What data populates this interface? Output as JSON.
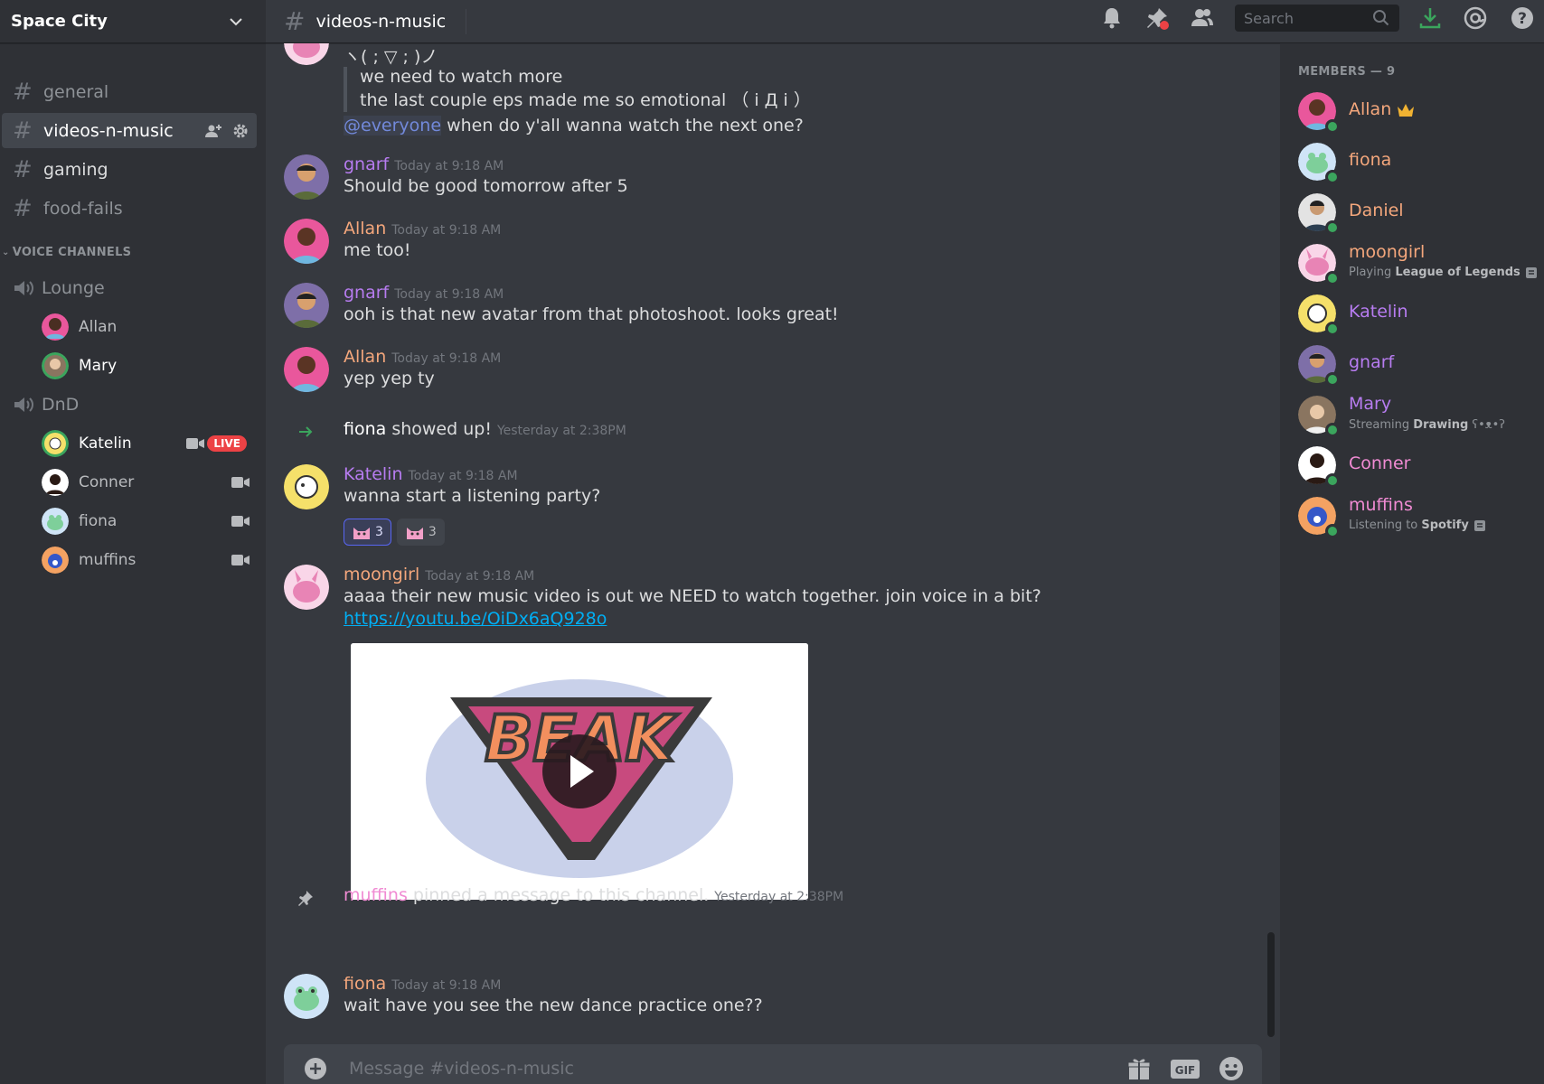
{
  "server": {
    "name": "Space City"
  },
  "text_channels": [
    {
      "name": "general",
      "state": "normal"
    },
    {
      "name": "videos-n-music",
      "state": "active"
    },
    {
      "name": "gaming",
      "state": "unread"
    },
    {
      "name": "food-fails",
      "state": "normal"
    }
  ],
  "voice": {
    "header": "VOICE CHANNELS",
    "channels": [
      {
        "name": "Lounge",
        "users": [
          {
            "name": "Allan"
          },
          {
            "name": "Mary"
          }
        ]
      },
      {
        "name": "DnD",
        "users": [
          {
            "name": "Katelin",
            "video": true,
            "live": "LIVE"
          },
          {
            "name": "Conner",
            "video": true
          },
          {
            "name": "fiona",
            "video": true
          },
          {
            "name": "muffins",
            "video": true
          }
        ]
      }
    ]
  },
  "header": {
    "channel": "videos-n-music",
    "search_placeholder": "Search"
  },
  "messages": {
    "top_kaomoji": "ヽ( ; ▽ ; )ノ",
    "quote_line1": "we need to watch more",
    "quote_line2": "the last couple eps made me so emotional （ i Д i ）",
    "everyone_mention": "@everyone",
    "everyone_text": " when do y'all wanna watch the next one?",
    "items": [
      {
        "author": "gnarf",
        "time": "Today at 9:18 AM",
        "text": "Should be good tomorrow after 5",
        "color": "#b77cf0"
      },
      {
        "author": "Allan",
        "time": "Today at 9:18 AM",
        "text": "me too!",
        "color": "#f4a77c"
      },
      {
        "author": "gnarf",
        "time": "Today at 9:18 AM",
        "text": "ooh is that new avatar from that photoshoot. looks great!",
        "color": "#b77cf0"
      },
      {
        "author": "Allan",
        "time": "Today at 9:18 AM",
        "text": "yep yep ty",
        "color": "#f4a77c"
      }
    ],
    "join": {
      "user": "fiona",
      "text": " showed up!",
      "time": "Yesterday at 2:38PM"
    },
    "katelin": {
      "author": "Katelin",
      "time": "Today at 9:18 AM",
      "text": "wanna start a listening party?",
      "color": "#b77cf0",
      "reactions": [
        {
          "count": "3"
        },
        {
          "count": "3"
        }
      ]
    },
    "moongirl": {
      "author": "moongirl",
      "time": "Today at 9:18 AM",
      "text": "aaaa their new music video is out we NEED to watch together. join voice in a bit?",
      "link": "https://youtu.be/OiDx6aQ928o",
      "color": "#f4a77c",
      "embed_title": "BEAK"
    },
    "pin": {
      "user": "muffins",
      "text": " pinned a message to this channel.",
      "time": "Yesterday at 2:38PM"
    },
    "fiona": {
      "author": "fiona",
      "time": "Today at 9:18 AM",
      "text": "wait have you see the new dance practice one??",
      "color": "#f4a77c"
    }
  },
  "composer": {
    "placeholder": "Message #videos-n-music",
    "gif_label": "GIF"
  },
  "members": {
    "title": "MEMBERS — 9",
    "list": [
      {
        "name": "Allan",
        "color": "#f4a77c",
        "owner": true
      },
      {
        "name": "fiona",
        "color": "#f4a77c"
      },
      {
        "name": "Daniel",
        "color": "#f4a77c"
      },
      {
        "name": "moongirl",
        "color": "#f4a77c",
        "status_pre": "Playing ",
        "status_bold": "League of Legends"
      },
      {
        "name": "Katelin",
        "color": "#b77cf0"
      },
      {
        "name": "gnarf",
        "color": "#b77cf0"
      },
      {
        "name": "Mary",
        "color": "#b77cf0",
        "status_pre": "Streaming ",
        "status_bold": "Drawing",
        "status_post": " ʕ•ᴥ•ʔ"
      },
      {
        "name": "Conner",
        "color": "#f08bd3"
      },
      {
        "name": "muffins",
        "color": "#f08bd3",
        "status_pre": "Listening to ",
        "status_bold": "Spotify"
      }
    ]
  },
  "colors": {
    "mention": "#7289da",
    "link": "#00aff4",
    "live": "#ed4245",
    "online": "#3ba55d",
    "download": "#3ba55d"
  }
}
